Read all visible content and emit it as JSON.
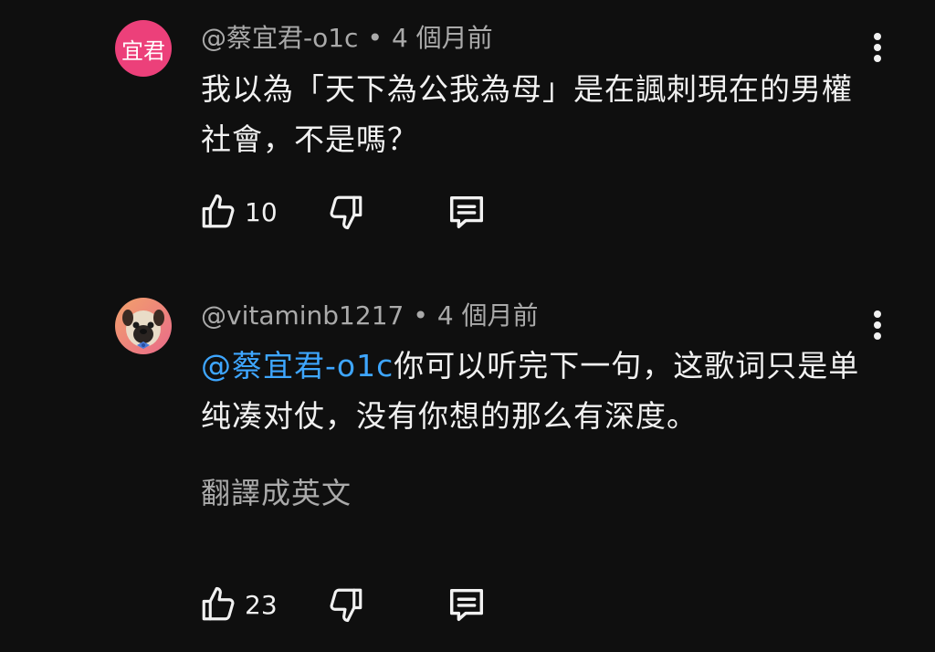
{
  "comments": [
    {
      "avatar_text": "宜君",
      "avatar_color": "#ec407a",
      "author": "@蔡宜君-o1c",
      "time": "4 個月前",
      "text": "我以為「天下為公我為母」是在諷刺現在的男權社會，不是嗎？",
      "likes": "10",
      "icons": {
        "like": "thumbs-up-icon",
        "dislike": "thumbs-down-icon",
        "reply": "reply-comment-icon",
        "more": "more-vertical-icon"
      }
    },
    {
      "avatar_icon": "pug-avatar",
      "author": "@vitaminb1217",
      "time": "4 個月前",
      "mention": "@蔡宜君-o1c",
      "text": "你可以听完下一句，这歌词只是单纯凑对仗，没有你想的那么有深度。",
      "translate_label": "翻譯成英文",
      "likes": "23",
      "icons": {
        "like": "thumbs-up-icon",
        "dislike": "thumbs-down-icon",
        "reply": "reply-comment-icon",
        "more": "more-vertical-icon"
      }
    }
  ],
  "colors": {
    "background": "#0f0f0f",
    "text": "#f1f1f1",
    "meta": "#aaaaaa",
    "mention": "#3ea6ff"
  }
}
